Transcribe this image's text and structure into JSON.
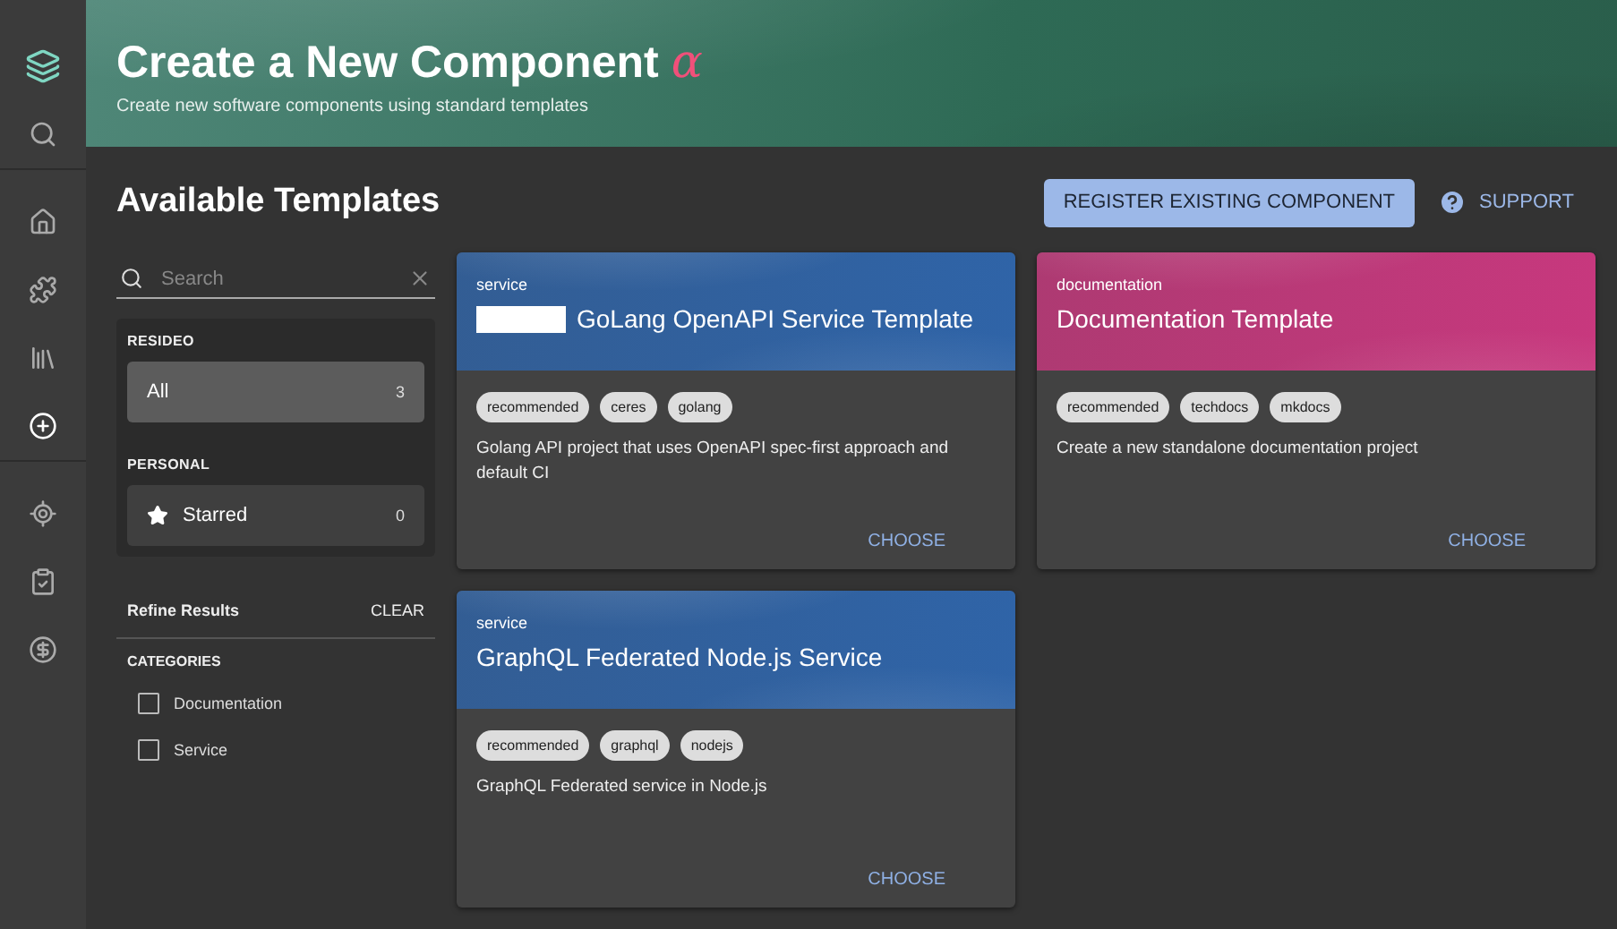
{
  "nav": [
    {
      "kind": "logo"
    },
    {
      "kind": "search",
      "selected": false
    },
    {
      "kind": "divider"
    },
    {
      "kind": "home",
      "selected": false
    },
    {
      "kind": "puzzle",
      "selected": false
    },
    {
      "kind": "library",
      "selected": false
    },
    {
      "kind": "create",
      "selected": true
    },
    {
      "kind": "divider"
    },
    {
      "kind": "target",
      "selected": false
    },
    {
      "kind": "clipboard",
      "selected": false
    },
    {
      "kind": "dollar",
      "selected": false
    }
  ],
  "header": {
    "title": "Create a New Component",
    "title_mark": "α",
    "subtitle": "Create new software components using standard templates"
  },
  "page_title": "Available Templates",
  "register_button": "REGISTER EXISTING COMPONENT",
  "support_link": "SUPPORT",
  "search": {
    "placeholder": "Search"
  },
  "filter_groups": [
    {
      "heading": "RESIDEO",
      "items": [
        {
          "label": "All",
          "count": "3",
          "starred": false,
          "selected": true
        }
      ]
    },
    {
      "heading": "PERSONAL",
      "items": [
        {
          "label": "Starred",
          "count": "0",
          "starred": true,
          "selected": false
        }
      ]
    }
  ],
  "refine": {
    "title": "Refine Results",
    "clear": "CLEAR",
    "categories_heading": "CATEGORIES",
    "categories": [
      {
        "label": "Documentation",
        "checked": false
      },
      {
        "label": "Service",
        "checked": false
      }
    ]
  },
  "cards": [
    {
      "type": "service",
      "title": "GoLang OpenAPI Service Template",
      "redacted": true,
      "color": "#2f64a8",
      "tags": [
        "recommended",
        "ceres",
        "golang"
      ],
      "description": "Golang API project that uses OpenAPI spec-first approach and default CI",
      "action": "CHOOSE"
    },
    {
      "type": "documentation",
      "title": "Documentation Template",
      "color": "#c8387e",
      "tags": [
        "recommended",
        "techdocs",
        "mkdocs"
      ],
      "description": "Create a new standalone documentation project",
      "action": "CHOOSE"
    },
    {
      "type": "service",
      "title": "GraphQL Federated Node.js Service",
      "color": "#2f64a8",
      "tags": [
        "recommended",
        "graphql",
        "nodejs"
      ],
      "description": "GraphQL Federated service in Node.js",
      "action": "CHOOSE"
    }
  ]
}
